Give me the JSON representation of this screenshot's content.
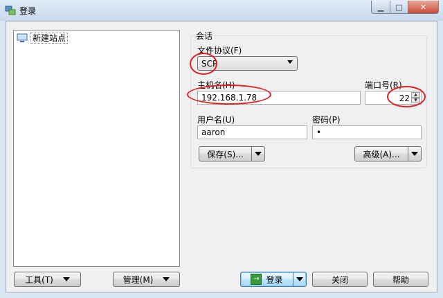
{
  "window": {
    "title": "登录"
  },
  "tree": {
    "items": [
      {
        "label": "新建站点"
      }
    ]
  },
  "session": {
    "group_title": "会话",
    "protocol_label": "文件协议(F)",
    "protocol_value": "SCP",
    "host_label": "主机名(H)",
    "host_value": "192.168.1.78",
    "port_label": "端口号(R)",
    "port_value": "22",
    "user_label": "用户名(U)",
    "user_value": "aaron",
    "password_label": "密码(P)",
    "password_value": "•",
    "save_label": "保存(S)...",
    "advanced_label": "高级(A)..."
  },
  "footer": {
    "tools_label": "工具(T)",
    "manage_label": "管理(M)",
    "login_label": "登录",
    "close_label": "关闭",
    "help_label": "帮助"
  },
  "colors": {
    "annotation": "#e02020",
    "default_button": "#3c7fb1"
  }
}
